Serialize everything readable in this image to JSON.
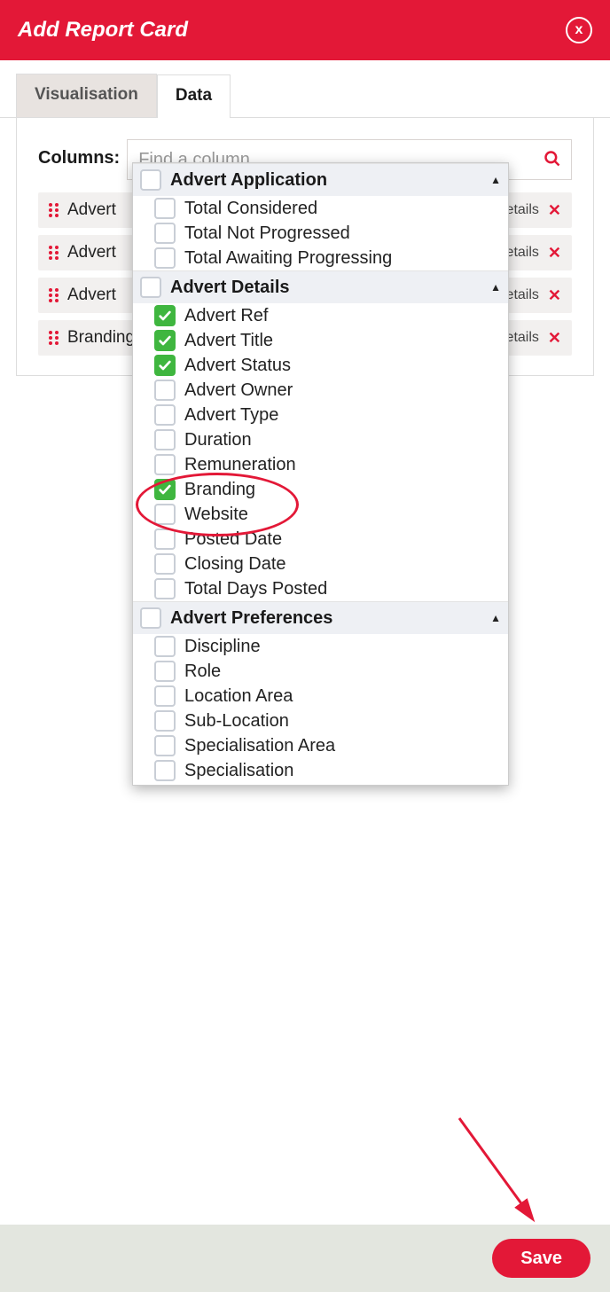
{
  "header": {
    "title": "Add Report Card",
    "close_icon": "x"
  },
  "tabs": {
    "visualisation": "Visualisation",
    "data": "Data",
    "active": "data"
  },
  "columns_label": "Columns:",
  "search": {
    "placeholder": "Find a column..."
  },
  "selected_columns": [
    {
      "label": "Advert Ref",
      "group": "Advert Details"
    },
    {
      "label": "Advert Title",
      "group": "Advert Details"
    },
    {
      "label": "Advert Status",
      "group": "Advert Details"
    },
    {
      "label": "Branding",
      "group": "Advert Details"
    }
  ],
  "selected_group_suffix": "Details",
  "remove_icon": "✕",
  "dropdown": {
    "groups": [
      {
        "name": "Advert Application",
        "checked": false,
        "options": [
          {
            "label": "Total Considered",
            "checked": false
          },
          {
            "label": "Total Not Progressed",
            "checked": false
          },
          {
            "label": "Total Awaiting Progressing",
            "checked": false
          }
        ]
      },
      {
        "name": "Advert Details",
        "checked": false,
        "options": [
          {
            "label": "Advert Ref",
            "checked": true
          },
          {
            "label": "Advert Title",
            "checked": true
          },
          {
            "label": "Advert Status",
            "checked": true
          },
          {
            "label": "Advert Owner",
            "checked": false
          },
          {
            "label": "Advert Type",
            "checked": false
          },
          {
            "label": "Duration",
            "checked": false
          },
          {
            "label": "Remuneration",
            "checked": false
          },
          {
            "label": "Branding",
            "checked": true
          },
          {
            "label": "Website",
            "checked": false
          },
          {
            "label": "Posted Date",
            "checked": false
          },
          {
            "label": "Closing Date",
            "checked": false
          },
          {
            "label": "Total Days Posted",
            "checked": false
          }
        ]
      },
      {
        "name": "Advert Preferences",
        "checked": false,
        "options": [
          {
            "label": "Discipline",
            "checked": false
          },
          {
            "label": "Role",
            "checked": false
          },
          {
            "label": "Location Area",
            "checked": false
          },
          {
            "label": "Sub-Location",
            "checked": false
          },
          {
            "label": "Specialisation Area",
            "checked": false
          },
          {
            "label": "Specialisation",
            "checked": false
          }
        ]
      }
    ]
  },
  "footer": {
    "save": "Save"
  },
  "annotations": {
    "highlight_option": "Branding",
    "arrow_target": "save-button"
  }
}
